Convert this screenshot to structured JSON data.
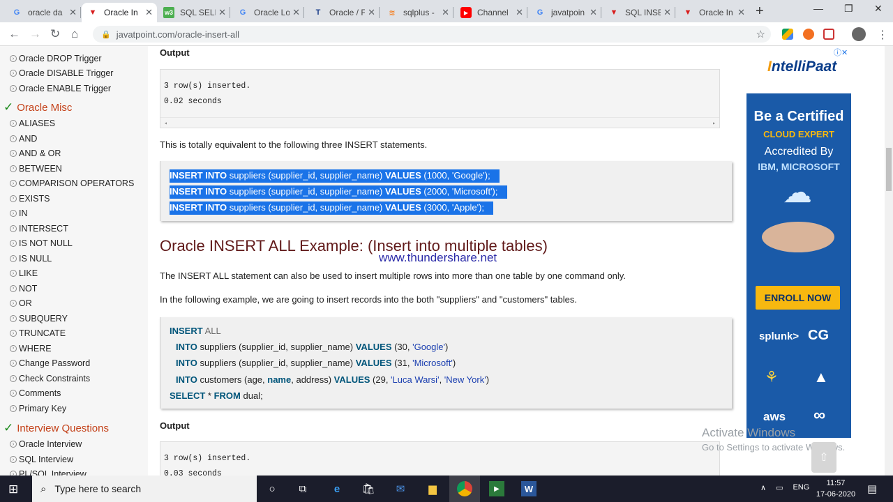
{
  "browser": {
    "tabs": [
      {
        "title": "oracle da",
        "icon": "google-icon",
        "active": false
      },
      {
        "title": "Oracle In",
        "icon": "javatpoint-icon",
        "active": true
      },
      {
        "title": "SQL SELE",
        "icon": "w3schools-icon",
        "active": false
      },
      {
        "title": "Oracle Lo",
        "icon": "google-icon",
        "active": false
      },
      {
        "title": "Oracle / F",
        "icon": "techonthenet-icon",
        "active": false
      },
      {
        "title": "sqlplus -",
        "icon": "stackoverflow-icon",
        "active": false
      },
      {
        "title": "Channel",
        "icon": "youtube-icon",
        "active": false
      },
      {
        "title": "javatpoin",
        "icon": "google-icon",
        "active": false
      },
      {
        "title": "SQL INSE",
        "icon": "javatpoint-icon",
        "active": false
      },
      {
        "title": "Oracle In",
        "icon": "javatpoint-icon",
        "active": false
      }
    ],
    "new_tab": "+",
    "url": "javatpoint.com/oracle-insert-all"
  },
  "sidebar": {
    "items_top": [
      "Oracle DROP Trigger",
      "Oracle DISABLE Trigger",
      "Oracle ENABLE Trigger"
    ],
    "section1": "Oracle Misc",
    "misc_items": [
      "ALIASES",
      "AND",
      "AND & OR",
      "BETWEEN",
      "COMPARISON OPERATORS",
      "EXISTS",
      "IN",
      "INTERSECT",
      "IS NOT NULL",
      "IS NULL",
      "LIKE",
      "NOT",
      "OR",
      "SUBQUERY",
      "TRUNCATE",
      "WHERE",
      "Change Password",
      "Check Constraints",
      "Comments",
      "Primary Key"
    ],
    "section2": "Interview Questions",
    "interview_items": [
      "Oracle Interview",
      "SQL Interview",
      "PL/SQL Interview"
    ]
  },
  "main": {
    "output_heading": "Output",
    "output1": {
      "line1": "3 row(s) inserted.",
      "line2": "0.02 seconds"
    },
    "equiv_text": "This is totally equivalent to the following three INSERT statements.",
    "insert_lines": [
      {
        "kw": "INSERT INTO",
        "mid": " suppliers (supplier_id, supplier_name) ",
        "kw2": "VALUES",
        "tail": " (1000, 'Google');"
      },
      {
        "kw": "INSERT INTO",
        "mid": " suppliers (supplier_id, supplier_name) ",
        "kw2": "VALUES",
        "tail": " (2000, 'Microsoft');"
      },
      {
        "kw": "INSERT INTO",
        "mid": " suppliers (supplier_id, supplier_name) ",
        "kw2": "VALUES",
        "tail": " (3000, 'Apple');"
      }
    ],
    "heading2": "Oracle INSERT ALL Example: (Insert into multiple tables)",
    "watermark": "www.thundershare.net",
    "para1": "The INSERT ALL statement can also be used to insert multiple rows into more than one table by one command only.",
    "para2": "In the following example, we are going to insert records into the both \"suppliers\" and \"customers\" tables.",
    "code2": {
      "l1_kw": "INSERT",
      "l1_rest": " ALL",
      "l2_kw": "INTO",
      "l2_mid": " suppliers (supplier_id, supplier_name) ",
      "l2_kw2": "VALUES",
      "l2_a": " (30, ",
      "l2_s": "'Google'",
      "l2_b": ")",
      "l3_kw": "INTO",
      "l3_mid": " suppliers (supplier_id, supplier_name) ",
      "l3_kw2": "VALUES",
      "l3_a": " (31, ",
      "l3_s": "'Microsoft'",
      "l3_b": ")",
      "l4_kw": "INTO",
      "l4_mid": " customers (age, ",
      "l4_name": "name",
      "l4_mid2": ", address) ",
      "l4_kw2": "VALUES",
      "l4_a": " (29, ",
      "l4_s1": "'Luca Warsi'",
      "l4_c": ", ",
      "l4_s2": "'New York'",
      "l4_b": ")",
      "l5_kw": "SELECT",
      "l5_mid": " * ",
      "l5_kw2": "FROM",
      "l5_b": " dual;"
    },
    "output2": {
      "line1": "3 row(s) inserted.",
      "line2": "0.03 seconds"
    }
  },
  "ad": {
    "logo_a": "I",
    "logo_b": "ntelliPaat",
    "line1": "Be a Certified",
    "line2": "CLOUD EXPERT",
    "line3": "Accredited By",
    "line4": "IBM, MICROSOFT",
    "cta": "ENROLL NOW",
    "brand1": "splunk>",
    "brand2": "aws"
  },
  "activation": {
    "title": "Activate Windows",
    "subtitle": "Go to Settings to activate Windows."
  },
  "taskbar": {
    "search_placeholder": "Type here to search",
    "lang": "ENG",
    "time": "11:57",
    "date": "17-06-2020"
  }
}
